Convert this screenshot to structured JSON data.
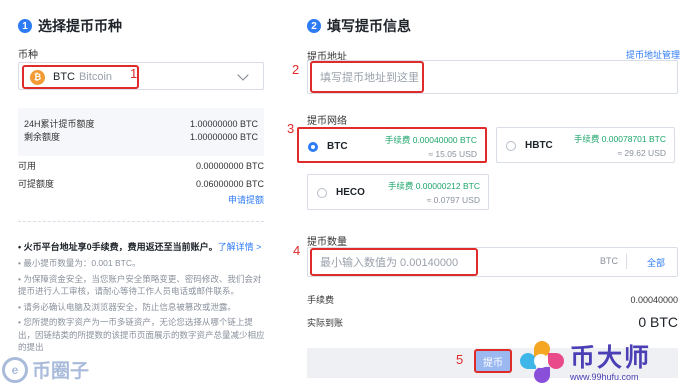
{
  "left": {
    "step_num": "1",
    "title": "选择提币币种",
    "currency_label": "币种",
    "coin": {
      "code": "BTC",
      "name": "Bitcoin",
      "icon": "bitcoin-icon",
      "icon_glyph": "₿"
    },
    "limits": [
      {
        "label": "24H累计提币额度",
        "value": "1.00000000 BTC"
      },
      {
        "label": "剩余额度",
        "value": "1.00000000 BTC"
      }
    ],
    "balances": [
      {
        "label": "可用",
        "value": "0.00000000 BTC"
      },
      {
        "label": "可提额度",
        "value": "0.06000000 BTC"
      }
    ],
    "apply_link": "申请提额",
    "notes": {
      "first": "• 火币平台地址享0手续费，费用返还至当前账户。",
      "first_link": "了解详情 >",
      "items": [
        "• 最小提币数量为：0.001 BTC。",
        "• 为保障资金安全，当您账户安全策略变更、密码修改、我们会对提币进行人工审核，请耐心等待工作人员电话或邮件联系。",
        "• 请务必确认电脑及浏览器安全，防止信息被篡改或泄露。",
        "• 您所提的数字资产为一币多链资产，无论您选择从哪个链上提出，因链结类的所提数的该提币页面展示的数字资产总量减少相应的提出"
      ]
    }
  },
  "right": {
    "step_num": "2",
    "title": "填写提币信息",
    "address_label": "提币地址",
    "address_manage": "提币地址管理",
    "address_placeholder": "填写提币地址到这里",
    "network_label": "提币网络",
    "networks": [
      {
        "name": "BTC",
        "fee": "手续费 0.00040000 BTC",
        "usd": "≈ 15.05 USD",
        "selected": true
      },
      {
        "name": "HBTC",
        "fee": "手续费 0.00078701 BTC",
        "usd": "≈ 29.62 USD",
        "selected": false
      },
      {
        "name": "HECO",
        "fee": "手续费 0.00000212 BTC",
        "usd": "≈ 0.0797 USD",
        "selected": false
      }
    ],
    "amount_label": "提币数量",
    "amount_placeholder": "最小输入数值为 0.00140000",
    "amount_unit": "BTC",
    "amount_all": "全部",
    "fee_label": "手续费",
    "fee_value": "0.00040000",
    "received_label": "实际到账",
    "received_value": "0 BTC",
    "submit_label": "提币"
  },
  "annotations": [
    "1",
    "2",
    "3",
    "4",
    "5"
  ],
  "watermarks": {
    "left_text": "币圈子",
    "left_logo": "e",
    "right_title": "币大师",
    "right_url": "www.99hufu.com"
  },
  "colors": {
    "accent": "#2d7bf5",
    "annotation_red": "#e02b2b",
    "fee_green": "#1ea66b",
    "btc_orange": "#f29a33"
  }
}
